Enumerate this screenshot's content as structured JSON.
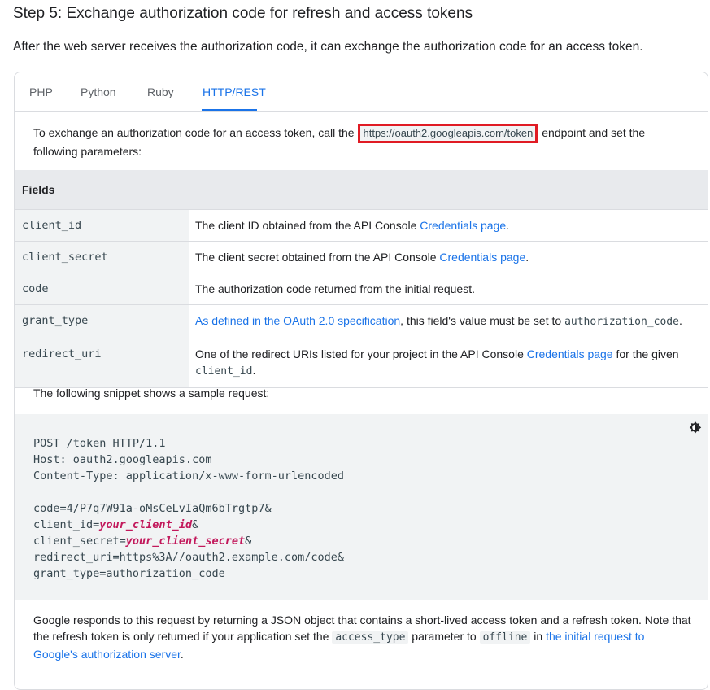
{
  "heading": "Step 5: Exchange authorization code for refresh and access tokens",
  "intro": "After the web server receives the authorization code, it can exchange the authorization code for an access token.",
  "tabs": [
    {
      "label": "PHP"
    },
    {
      "label": "Python"
    },
    {
      "label": "Ruby"
    },
    {
      "label": "HTTP/REST",
      "active": true
    }
  ],
  "exchange": {
    "before": "To exchange an authorization code for an access token, call the ",
    "url": "https://oauth2.googleapis.com/token",
    "after": " endpoint and set the following parameters:"
  },
  "fields_table": {
    "header": "Fields",
    "rows": [
      {
        "name": "client_id",
        "desc_text": "The client ID obtained from the API Console ",
        "desc_link": "Credentials page",
        "desc_end": "."
      },
      {
        "name": "client_secret",
        "desc_text": "The client secret obtained from the API Console ",
        "desc_link": "Credentials page",
        "desc_end": "."
      },
      {
        "name": "code",
        "desc_text": "The authorization code returned from the initial request."
      },
      {
        "name": "grant_type",
        "desc_link": "As defined in the OAuth 2.0 specification",
        "desc_text": ", this field's value must be set to ",
        "desc_code": "authorization_code",
        "desc_end": "."
      },
      {
        "name": "redirect_uri",
        "desc_text": "One of the redirect URIs listed for your project in the API Console ",
        "desc_link": "Credentials page",
        "desc_after": " for the given ",
        "desc_code": "client_id",
        "desc_end": "."
      }
    ]
  },
  "snippet_intro": "The following snippet shows a sample request:",
  "code": {
    "line1": "POST /token HTTP/1.1",
    "line2": "Host: oauth2.googleapis.com",
    "line3": "Content-Type: application/x-www-form-urlencoded",
    "line4": "code=4/P7q7W91a-oMsCeLvIaQm6bTrgtp7&",
    "line5a": "client_id=",
    "line5var": "your_client_id",
    "line5b": "&",
    "line6a": "client_secret=",
    "line6var": "your_client_secret",
    "line6b": "&",
    "line7": "redirect_uri=https%3A//oauth2.example.com/code&",
    "line8": "grant_type=authorization_code",
    "theme_icon": "brightness-icon"
  },
  "response": {
    "t1": "Google responds to this request by returning a JSON object that contains a short-lived access token and a refresh token. Note that the refresh token is only returned if your application set the ",
    "c1": "access_type",
    "t2": " parameter to ",
    "c2": "offline",
    "t3": " in ",
    "link": "the initial request to Google's authorization server",
    "t4": "."
  },
  "colors": {
    "accent": "#1a73e8",
    "highlight_box": "#e01b24",
    "code_var": "#c2185b"
  }
}
